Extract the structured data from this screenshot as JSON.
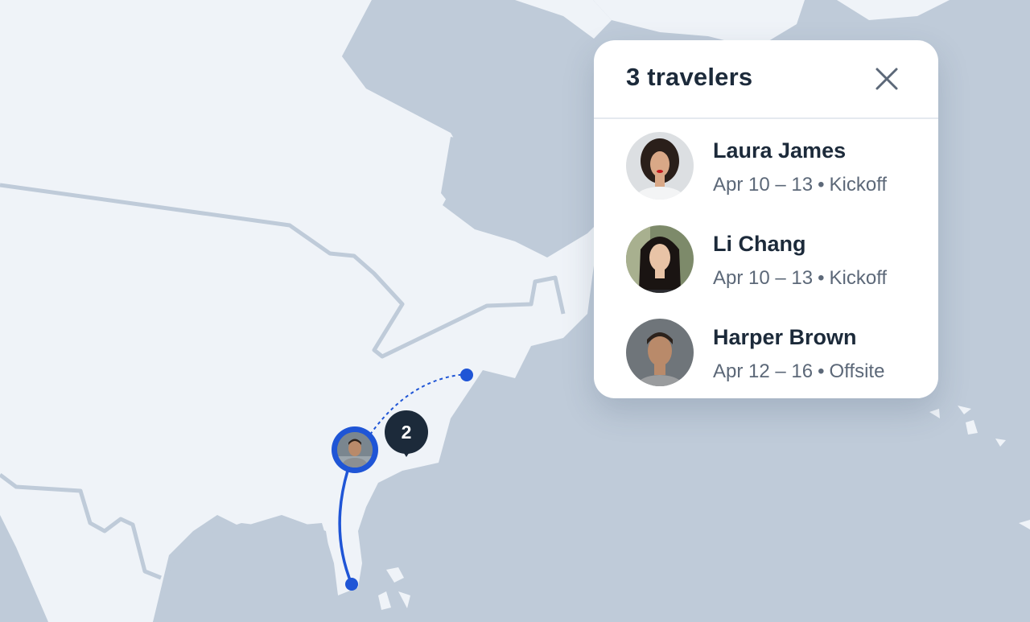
{
  "panel": {
    "title": "3 travelers",
    "close_icon": "close-icon"
  },
  "travelers": [
    {
      "name": "Laura James",
      "dates": "Apr 10 – 13",
      "separator": "•",
      "event": "Kickoff"
    },
    {
      "name": "Li Chang",
      "dates": "Apr 10 – 13",
      "separator": "•",
      "event": "Kickoff"
    },
    {
      "name": "Harper Brown",
      "dates": "Apr 12 – 16",
      "separator": "•",
      "event": "Offsite"
    }
  ],
  "map": {
    "cluster_count": "2",
    "route_color": "#1f55d6",
    "land_color": "#eff3f8",
    "water_color": "#bfcbd9"
  }
}
